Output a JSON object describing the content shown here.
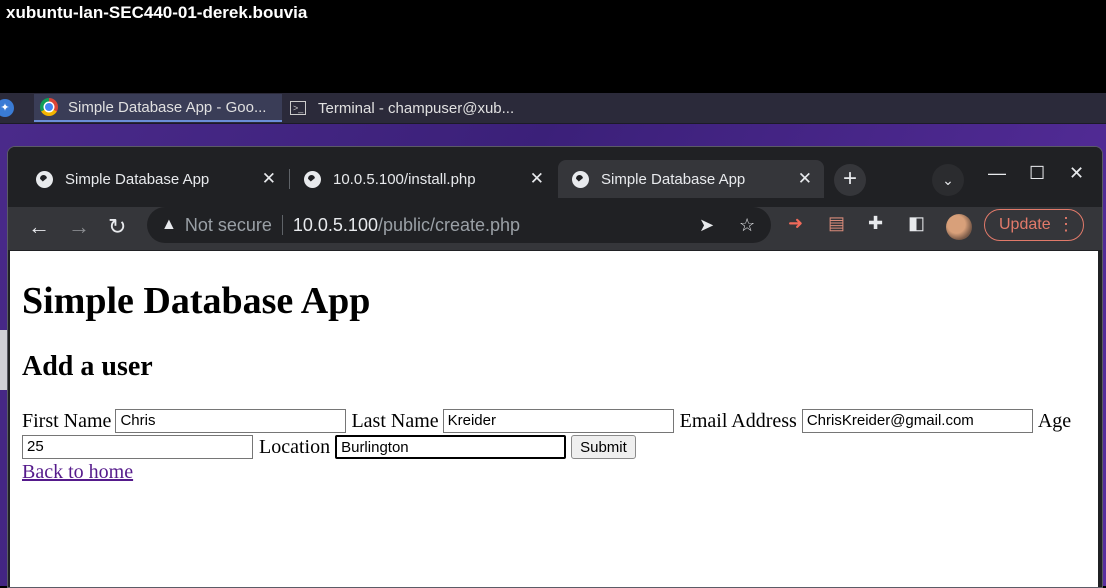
{
  "vm": {
    "title": "xubuntu-lan-SEC440-01-derek.bouvia"
  },
  "taskbar": {
    "items": [
      {
        "label": "Simple Database App - Goo..."
      },
      {
        "label": "Terminal - champuser@xub..."
      }
    ]
  },
  "browser": {
    "tabs": [
      {
        "title": "Simple Database App"
      },
      {
        "title": "10.0.5.100/install.php"
      },
      {
        "title": "Simple Database App"
      }
    ],
    "address": {
      "security_label": "Not secure",
      "host": "10.0.5.100",
      "path": "/public/create.php"
    },
    "update_label": "Update"
  },
  "page": {
    "heading": "Simple Database App",
    "subheading": "Add a user",
    "form": {
      "first_name_label": "First Name",
      "first_name_value": "Chris",
      "last_name_label": "Last Name",
      "last_name_value": "Kreider",
      "email_label": "Email Address",
      "email_value": "ChrisKreider@gmail.com",
      "age_label": "Age",
      "age_value": "25",
      "location_label": "Location",
      "location_value": "Burlington",
      "submit_label": "Submit"
    },
    "back_link": "Back to home"
  }
}
